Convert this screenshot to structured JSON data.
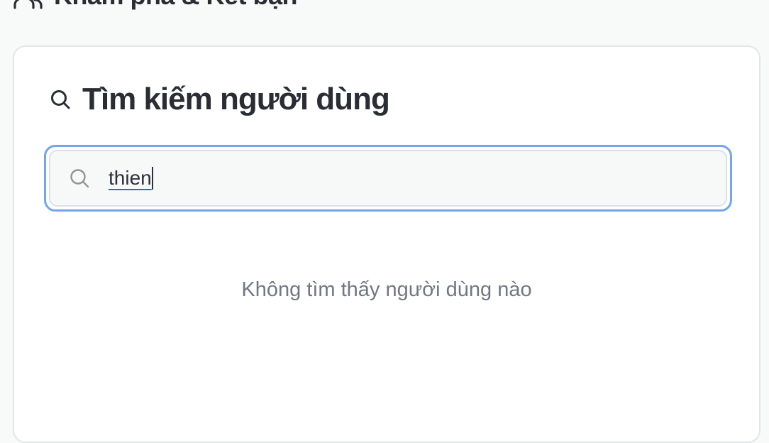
{
  "header": {
    "title": "Khám phá & Kết bạn",
    "icon": "people-icon"
  },
  "search_section": {
    "title": "Tìm kiếm người dùng",
    "title_icon": "search-icon",
    "input_value": "thien",
    "input_icon": "search-icon",
    "empty_message": "Không tìm thấy người dùng nào"
  },
  "colors": {
    "background": "#f8f9f9",
    "card": "#ffffff",
    "focus_ring": "#73a5ec",
    "title_text": "#2a2d34",
    "muted_text": "#717783",
    "input_bg": "#f7f8f8"
  }
}
